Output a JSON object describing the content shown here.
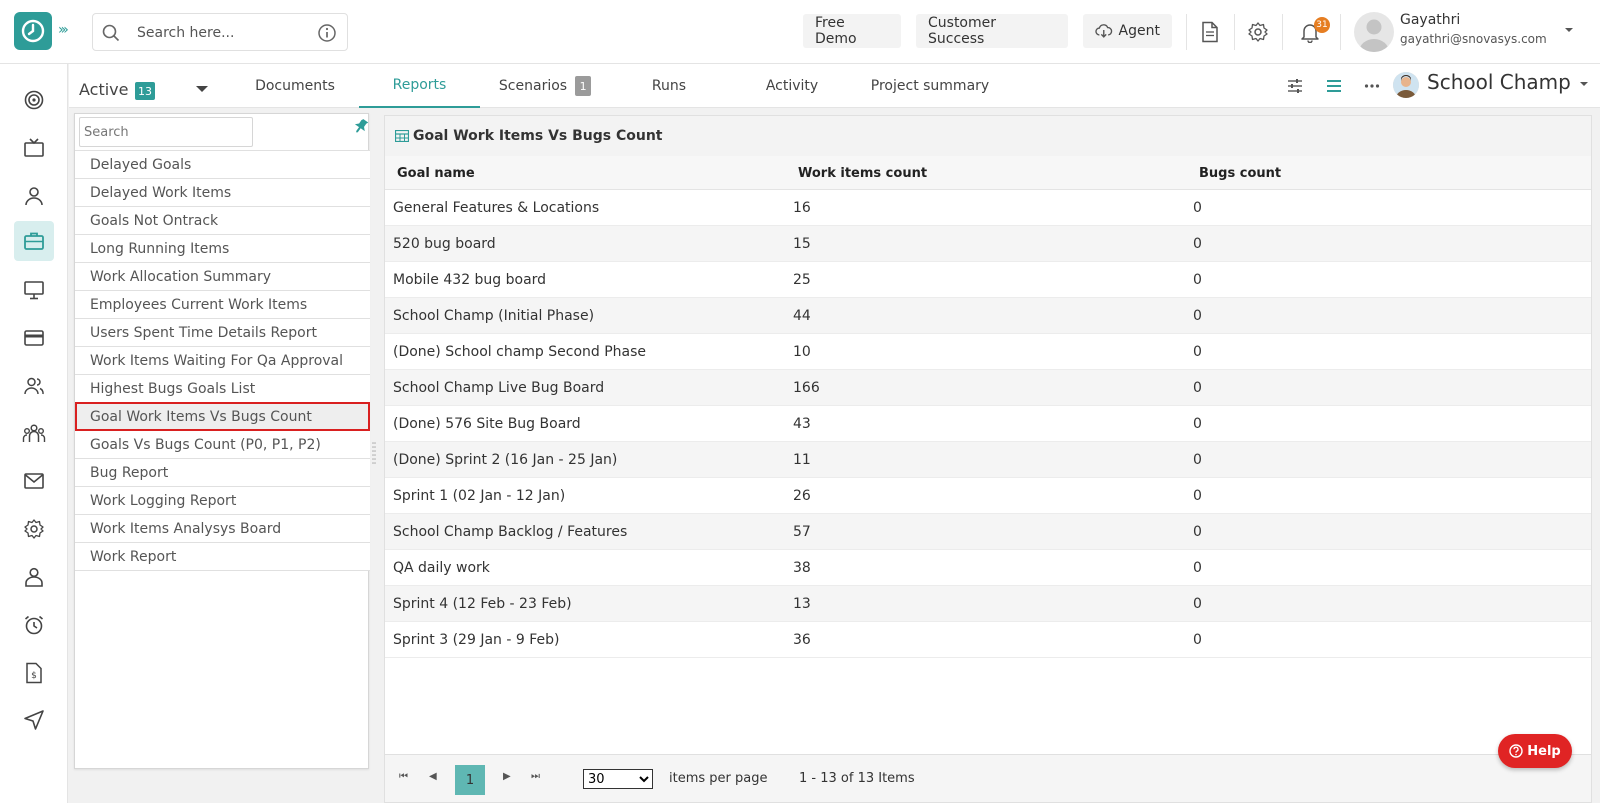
{
  "header": {
    "search_placeholder": "Search here...",
    "buttons": {
      "free_demo": "Free Demo",
      "customer_success": "Customer Success",
      "agent": "Agent"
    },
    "notification_count": "31",
    "user": {
      "name": "Gayathri",
      "email": "gayathri@snovasys.com"
    }
  },
  "project_tabs": {
    "active_label": "Active",
    "active_count": "13",
    "tabs": [
      {
        "label": "Documents"
      },
      {
        "label": "Reports"
      },
      {
        "label": "Scenarios",
        "count": "1"
      },
      {
        "label": "Runs"
      },
      {
        "label": "Activity"
      },
      {
        "label": "Project summary"
      }
    ],
    "selected_tab": "Reports",
    "project_name": "School Champ"
  },
  "report_list": {
    "search_placeholder": "Search",
    "items": [
      "Delayed Goals",
      "Delayed Work Items",
      "Goals Not Ontrack",
      "Long Running Items",
      "Work Allocation Summary",
      "Employees Current Work Items",
      "Users Spent Time Details Report",
      "Work Items Waiting For Qa Approval",
      "Highest Bugs Goals List",
      "Goal Work Items Vs Bugs Count",
      "Goals Vs Bugs Count (P0, P1, P2)",
      "Bug Report",
      "Work Logging Report",
      "Work Items Analysys Board",
      "Work Report"
    ],
    "selected": "Goal Work Items Vs Bugs Count"
  },
  "report": {
    "title": "Goal Work Items Vs Bugs Count",
    "columns": [
      "Goal name",
      "Work items count",
      "Bugs count"
    ],
    "rows": [
      [
        "General Features & Locations",
        "16",
        "0"
      ],
      [
        "520 bug board",
        "15",
        "0"
      ],
      [
        "Mobile 432 bug board",
        "25",
        "0"
      ],
      [
        "School Champ (Initial Phase)",
        "44",
        "0"
      ],
      [
        "(Done) School champ Second Phase",
        "10",
        "0"
      ],
      [
        "School Champ Live Bug Board",
        "166",
        "0"
      ],
      [
        "(Done) 576 Site Bug Board",
        "43",
        "0"
      ],
      [
        "(Done) Sprint 2 (16 Jan - 25 Jan)",
        "11",
        "0"
      ],
      [
        "Sprint 1 (02 Jan - 12 Jan)",
        "26",
        "0"
      ],
      [
        "School Champ Backlog / Features",
        "57",
        "0"
      ],
      [
        "QA daily work",
        "38",
        "0"
      ],
      [
        "Sprint 4 (12 Feb - 23 Feb)",
        "13",
        "0"
      ],
      [
        "Sprint 3 (29 Jan - 9 Feb)",
        "36",
        "0"
      ]
    ],
    "pager": {
      "current_page": "1",
      "page_size": "30",
      "page_size_options": [
        "30"
      ],
      "items_per_page_label": "items per page",
      "info": "1 - 13 of 13 Items"
    }
  },
  "help_label": "Help",
  "colors": {
    "accent": "#2e9c98",
    "highlight": "#d92020",
    "help": "#e02424",
    "badge": "#e67e22"
  }
}
